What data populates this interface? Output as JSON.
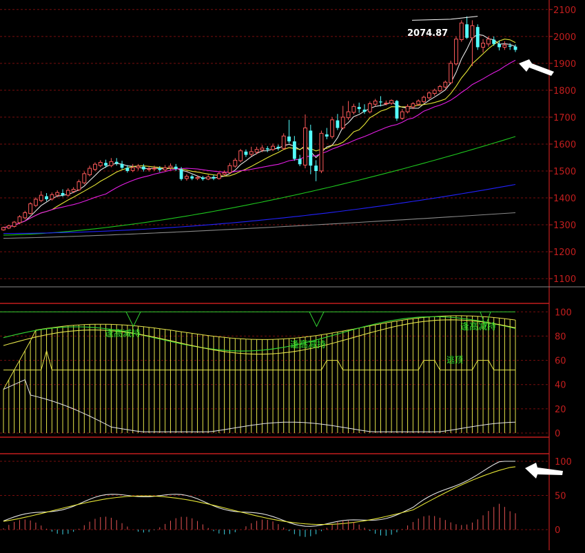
{
  "colors": {
    "background": "#000000",
    "axis_red": "#c41e1e",
    "grid_red": "#7a0e0e",
    "divider": "#8a8a8a",
    "candle_up": "#ff5a5a",
    "candle_down": "#54ffff",
    "ma_white": "#e6e6e6",
    "ma_yellow": "#e6e635",
    "ma_magenta": "#e61ee6",
    "ma_green": "#1ec81e",
    "ma_blue": "#2222ff",
    "ma_gray": "#8a8a8a",
    "bar_yellow": "#e6e64a",
    "ind_green": "#32d232",
    "label_green": "#2ee82e",
    "macd_pos": "#e85454",
    "macd_neg": "#3ed8e8"
  },
  "annotations": {
    "peak_price": "2074.87",
    "signal_label": "逢高减持",
    "signal_label_2": "逃顶"
  },
  "chart_data": [
    {
      "type": "candlestick",
      "name": "price",
      "yticks": [
        1100,
        1200,
        1300,
        1400,
        1500,
        1600,
        1700,
        1800,
        1900,
        2000,
        2100
      ],
      "ylim": [
        1090,
        2120
      ],
      "grid": true,
      "peak_label": "2074.87",
      "candles": [
        [
          1281,
          1290,
          1278,
          1293
        ],
        [
          1288,
          1296,
          1284,
          1300
        ],
        [
          1294,
          1310,
          1290,
          1314
        ],
        [
          1308,
          1330,
          1302,
          1336
        ],
        [
          1326,
          1345,
          1320,
          1352
        ],
        [
          1342,
          1378,
          1338,
          1384
        ],
        [
          1372,
          1395,
          1366,
          1402
        ],
        [
          1390,
          1410,
          1384,
          1425
        ],
        [
          1406,
          1395,
          1388,
          1418
        ],
        [
          1396,
          1412,
          1390,
          1420
        ],
        [
          1410,
          1420,
          1402,
          1428
        ],
        [
          1418,
          1410,
          1404,
          1432
        ],
        [
          1410,
          1428,
          1404,
          1436
        ],
        [
          1424,
          1432,
          1418,
          1440
        ],
        [
          1430,
          1460,
          1426,
          1468
        ],
        [
          1456,
          1490,
          1450,
          1498
        ],
        [
          1486,
          1510,
          1480,
          1520
        ],
        [
          1506,
          1525,
          1500,
          1532
        ],
        [
          1520,
          1532,
          1514,
          1540
        ],
        [
          1530,
          1520,
          1512,
          1542
        ],
        [
          1520,
          1535,
          1514,
          1548
        ],
        [
          1534,
          1528,
          1520,
          1548
        ],
        [
          1526,
          1512,
          1506,
          1538
        ],
        [
          1512,
          1500,
          1494,
          1522
        ],
        [
          1502,
          1512,
          1496,
          1526
        ],
        [
          1512,
          1518,
          1502,
          1526
        ],
        [
          1516,
          1506,
          1498,
          1526
        ],
        [
          1506,
          1508,
          1498,
          1518
        ],
        [
          1508,
          1510,
          1500,
          1520
        ],
        [
          1510,
          1504,
          1496,
          1518
        ],
        [
          1504,
          1512,
          1498,
          1522
        ],
        [
          1512,
          1518,
          1504,
          1528
        ],
        [
          1516,
          1508,
          1500,
          1526
        ],
        [
          1506,
          1470,
          1464,
          1515
        ],
        [
          1472,
          1480,
          1464,
          1488
        ],
        [
          1480,
          1472,
          1466,
          1486
        ],
        [
          1472,
          1476,
          1466,
          1484
        ],
        [
          1476,
          1470,
          1464,
          1482
        ],
        [
          1470,
          1478,
          1466,
          1486
        ],
        [
          1478,
          1472,
          1466,
          1486
        ],
        [
          1472,
          1490,
          1468,
          1496
        ],
        [
          1488,
          1494,
          1482,
          1502
        ],
        [
          1494,
          1520,
          1490,
          1530
        ],
        [
          1518,
          1540,
          1512,
          1548
        ],
        [
          1538,
          1575,
          1532,
          1582
        ],
        [
          1572,
          1560,
          1552,
          1580
        ],
        [
          1562,
          1572,
          1554,
          1590
        ],
        [
          1570,
          1580,
          1562,
          1590
        ],
        [
          1578,
          1585,
          1570,
          1596
        ],
        [
          1584,
          1580,
          1570,
          1592
        ],
        [
          1580,
          1592,
          1574,
          1602
        ],
        [
          1590,
          1584,
          1576,
          1598
        ],
        [
          1584,
          1630,
          1578,
          1640
        ],
        [
          1628,
          1610,
          1602,
          1690
        ],
        [
          1610,
          1545,
          1538,
          1630
        ],
        [
          1545,
          1525,
          1518,
          1560
        ],
        [
          1522,
          1660,
          1510,
          1710
        ],
        [
          1650,
          1520,
          1488,
          1672
        ],
        [
          1520,
          1500,
          1462,
          1540
        ],
        [
          1500,
          1640,
          1492,
          1650
        ],
        [
          1636,
          1628,
          1618,
          1660
        ],
        [
          1628,
          1690,
          1620,
          1700
        ],
        [
          1688,
          1660,
          1652,
          1712
        ],
        [
          1660,
          1700,
          1654,
          1742
        ],
        [
          1698,
          1720,
          1690,
          1760
        ],
        [
          1718,
          1740,
          1710,
          1750
        ],
        [
          1738,
          1730,
          1716,
          1754
        ],
        [
          1728,
          1720,
          1712,
          1748
        ],
        [
          1720,
          1750,
          1714,
          1758
        ],
        [
          1748,
          1760,
          1740,
          1768
        ],
        [
          1758,
          1755,
          1740,
          1778
        ],
        [
          1752,
          1752,
          1744,
          1762
        ],
        [
          1752,
          1762,
          1746,
          1766
        ],
        [
          1760,
          1695,
          1686,
          1764
        ],
        [
          1696,
          1720,
          1690,
          1730
        ],
        [
          1720,
          1740,
          1714,
          1748
        ],
        [
          1738,
          1750,
          1730,
          1756
        ],
        [
          1748,
          1760,
          1742,
          1766
        ],
        [
          1758,
          1774,
          1752,
          1780
        ],
        [
          1772,
          1790,
          1766,
          1796
        ],
        [
          1788,
          1800,
          1780,
          1806
        ],
        [
          1798,
          1814,
          1792,
          1820
        ],
        [
          1812,
          1830,
          1806,
          1836
        ],
        [
          1828,
          1900,
          1822,
          1910
        ],
        [
          1898,
          1990,
          1892,
          2000
        ],
        [
          1988,
          2050,
          1980,
          2060
        ],
        [
          2045,
          1995,
          1990,
          2074.87
        ],
        [
          1995,
          2040,
          1890,
          2060
        ],
        [
          2035,
          1960,
          1950,
          2045
        ],
        [
          1960,
          1975,
          1940,
          1990
        ],
        [
          1972,
          1990,
          1962,
          2000
        ],
        [
          1988,
          1972,
          1965,
          2000
        ],
        [
          1972,
          1960,
          1948,
          1985
        ],
        [
          1960,
          1968,
          1950,
          1982
        ],
        [
          1966,
          1962,
          1950,
          1975
        ],
        [
          1962,
          1950,
          1942,
          1970
        ]
      ]
    },
    {
      "type": "bar+line",
      "name": "indicator",
      "yticks": [
        0,
        20,
        40,
        60,
        80,
        100
      ],
      "ylim": [
        0,
        103
      ],
      "labels": [
        "逢高减持",
        "逢高减持",
        "逢高减持",
        "逃顶"
      ]
    },
    {
      "type": "line+histogram",
      "name": "oscillator",
      "yticks": [
        0,
        50,
        100
      ],
      "ylim": [
        -20,
        105
      ]
    }
  ]
}
